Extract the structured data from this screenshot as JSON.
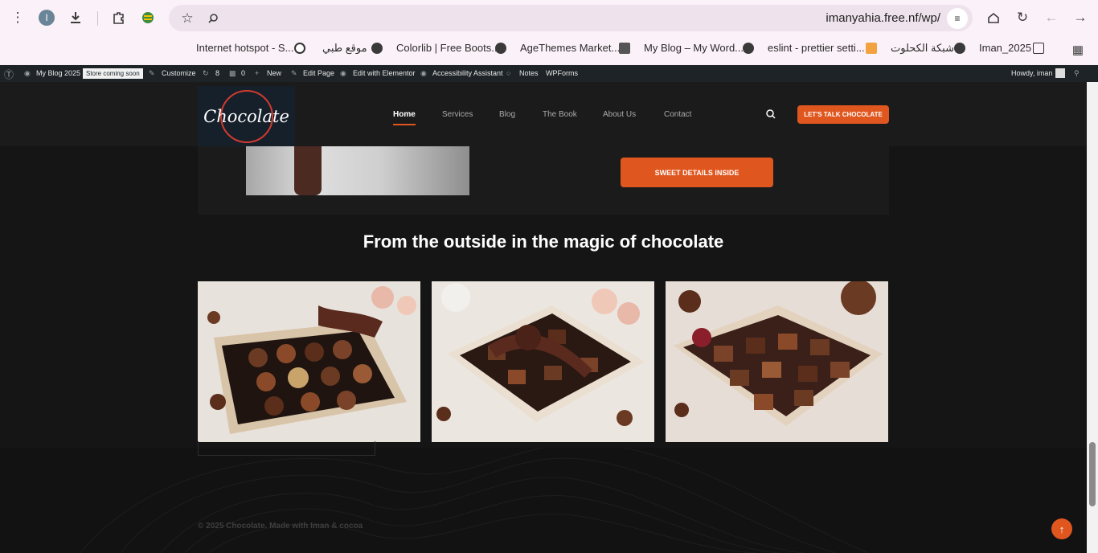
{
  "browser": {
    "profile_initial": "I",
    "url": "imanyahia.free.nf/wp/",
    "bookmarks": [
      "Internet hotspot - S...",
      "موقع طبي",
      "Colorlib | Free Boots...",
      "AgeThemes Market...",
      "My Blog – My Word...",
      "eslint - prettier setti...",
      "شبكة الكحلوت",
      "Iman_2025"
    ]
  },
  "adminbar": {
    "site": "My Blog 2025",
    "badge": "Store coming soon",
    "customize": "Customize",
    "updates": "8",
    "comments": "0",
    "new": "New",
    "edit_page": "Edit Page",
    "elementor": "Edit with Elementor",
    "accessibility": "Accessibility Assistant",
    "notes": "Notes",
    "wpforms": "WPForms",
    "howdy": "Howdy, iman"
  },
  "site": {
    "logo_text": "Chocolate",
    "nav": [
      "Home",
      "Services",
      "Blog",
      "The Book",
      "About Us",
      "Contact"
    ],
    "cta": "LET'S TALK CHOCOLATE",
    "sweet_button": "SWEET DETAILS INSIDE",
    "section_title": "From the outside in the magic of chocolate",
    "copyright": "© 2025 Chocolate. Made with Iman & cocoa"
  },
  "colors": {
    "accent": "#e0561f",
    "page_bg": "#151515",
    "admin_bar": "#1d2327"
  }
}
